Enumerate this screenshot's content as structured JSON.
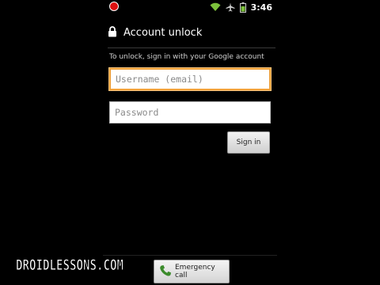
{
  "status_bar": {
    "time": "3:46",
    "icons": [
      "record-dot",
      "wifi-icon",
      "airplane-icon",
      "battery-icon"
    ]
  },
  "header": {
    "icon": "lock-icon",
    "title": "Account unlock"
  },
  "instruction": "To unlock, sign in with your Google account",
  "username": {
    "placeholder": "Username (email)",
    "value": ""
  },
  "password": {
    "placeholder": "Password",
    "value": ""
  },
  "signin_label": "Sign in",
  "emergency_label": "Emergency call",
  "watermark": "DROIDLESSONS.COM",
  "colors": {
    "focus": "#f3a33c",
    "record": "#d11111",
    "phone_icon": "#3b8b2b",
    "background": "#000000"
  }
}
